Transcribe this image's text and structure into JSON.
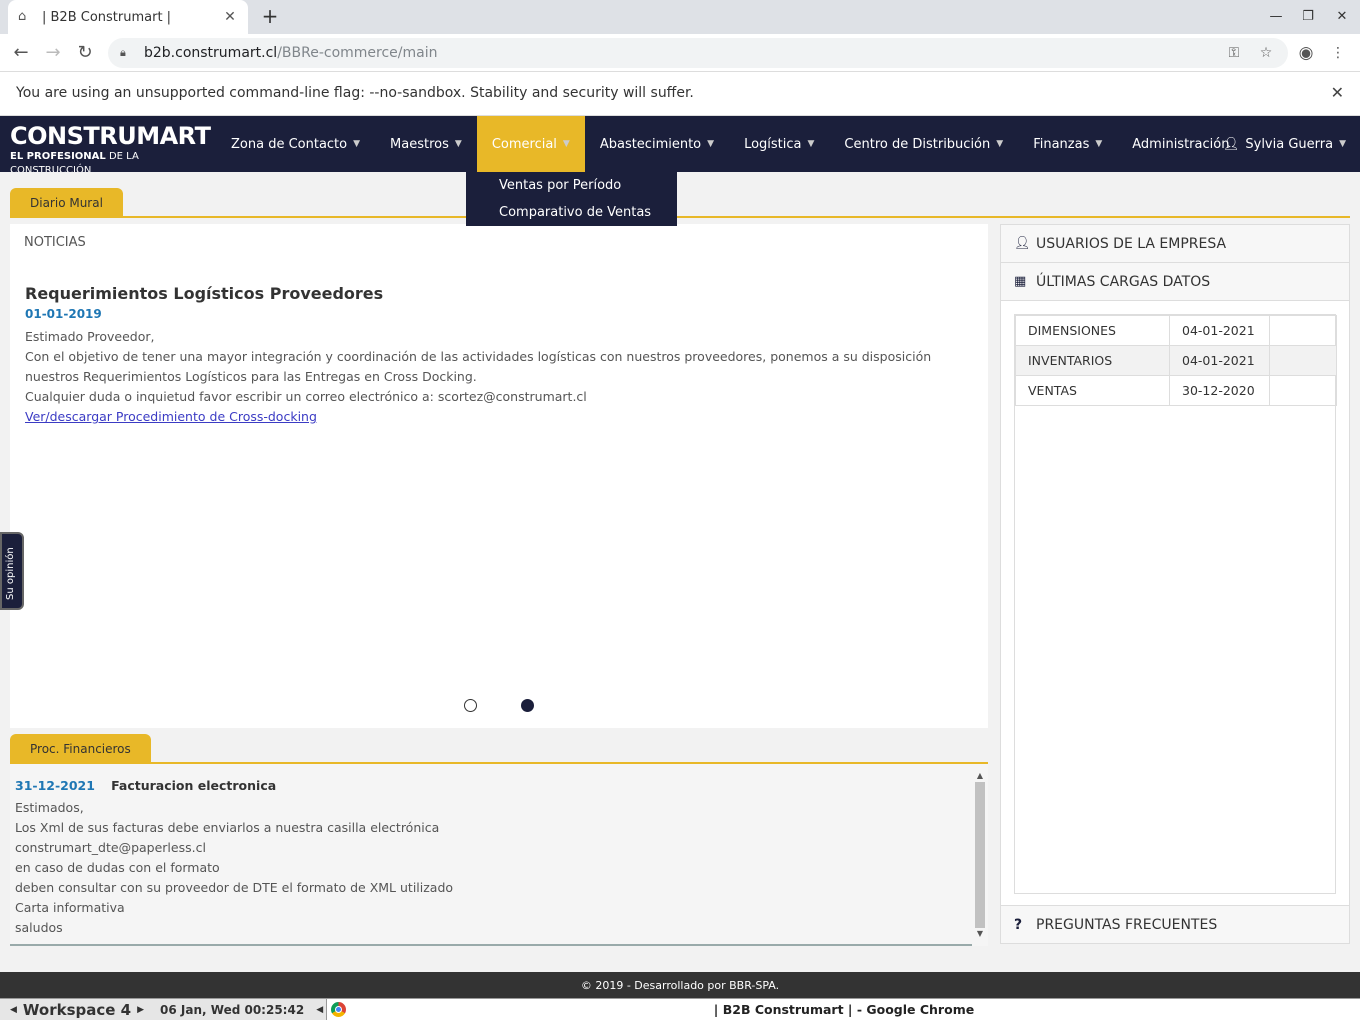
{
  "browser": {
    "tab_title": "| B2B Construmart |",
    "url_host": "b2b.construmart.cl",
    "url_path": "/BBRe-commerce/main",
    "infobar_message": "You are using an unsupported command-line flag: --no-sandbox. Stability and security will suffer."
  },
  "header": {
    "logo_word": "CONSTRUMART",
    "logo_tag_bold": "EL PROFESIONAL",
    "logo_tag_rest": " DE LA CONSTRUCCIÓN",
    "nav": [
      {
        "label": "Zona de Contacto"
      },
      {
        "label": "Maestros"
      },
      {
        "label": "Comercial"
      },
      {
        "label": "Abastecimiento"
      },
      {
        "label": "Logística"
      },
      {
        "label": "Centro de Distribución"
      },
      {
        "label": "Finanzas"
      },
      {
        "label": "Administración"
      }
    ],
    "user_name": "Sylvia Guerra",
    "dropdown": [
      "Ventas por Período",
      "Comparativo de Ventas"
    ]
  },
  "mural": {
    "tab_label": "Diario Mural",
    "section_label": "NOTICIAS",
    "news_title": "Requerimientos Logísticos Proveedores",
    "news_date": "01-01-2019",
    "news_lines": [
      "Estimado Proveedor,",
      "Con el objetivo de tener una mayor integración y coordinación de las actividades logísticas con nuestros proveedores, ponemos a su disposición nuestros Requerimientos Logísticos para las Entregas en Cross Docking.",
      "Cualquier duda o inquietud favor escribir un correo electrónico a: scortez@construmart.cl"
    ],
    "news_link": "Ver/descargar Procedimiento de Cross-docking",
    "slide_count": 2,
    "active_slide": 2
  },
  "opinion_label": "Su opinión",
  "financieros": {
    "tab_label": "Proc. Financieros",
    "date": "31-12-2021",
    "title": "Facturacion electronica",
    "lines": [
      "Estimados,",
      "Los Xml de sus facturas debe enviarlos a nuestra casilla electrónica",
      "construmart_dte@paperless.cl",
      "en caso de dudas con el formato",
      "deben consultar con su proveedor de DTE el formato de XML utilizado",
      "Carta informativa",
      "saludos"
    ]
  },
  "sidebar": {
    "usuarios_label": "USUARIOS DE LA EMPRESA",
    "cargas_label": "ÚLTIMAS CARGAS DATOS",
    "cargas": [
      {
        "name": "DIMENSIONES",
        "date": "04-01-2021",
        "extra": ""
      },
      {
        "name": "INVENTARIOS",
        "date": "04-01-2021",
        "extra": ""
      },
      {
        "name": "VENTAS",
        "date": "30-12-2020",
        "extra": ""
      }
    ],
    "faq_label": "PREGUNTAS FRECUENTES"
  },
  "footer_text": "© 2019 - Desarrollado por BBR-SPA.",
  "taskbar": {
    "workspace": "Workspace 4",
    "clock": "06 Jan, Wed 00:25:42",
    "window_title": "| B2B Construmart | - Google Chrome"
  },
  "colors": {
    "navy": "#1b1f3b",
    "accent_yellow": "#e8b828",
    "date_blue": "#1f77b4"
  }
}
